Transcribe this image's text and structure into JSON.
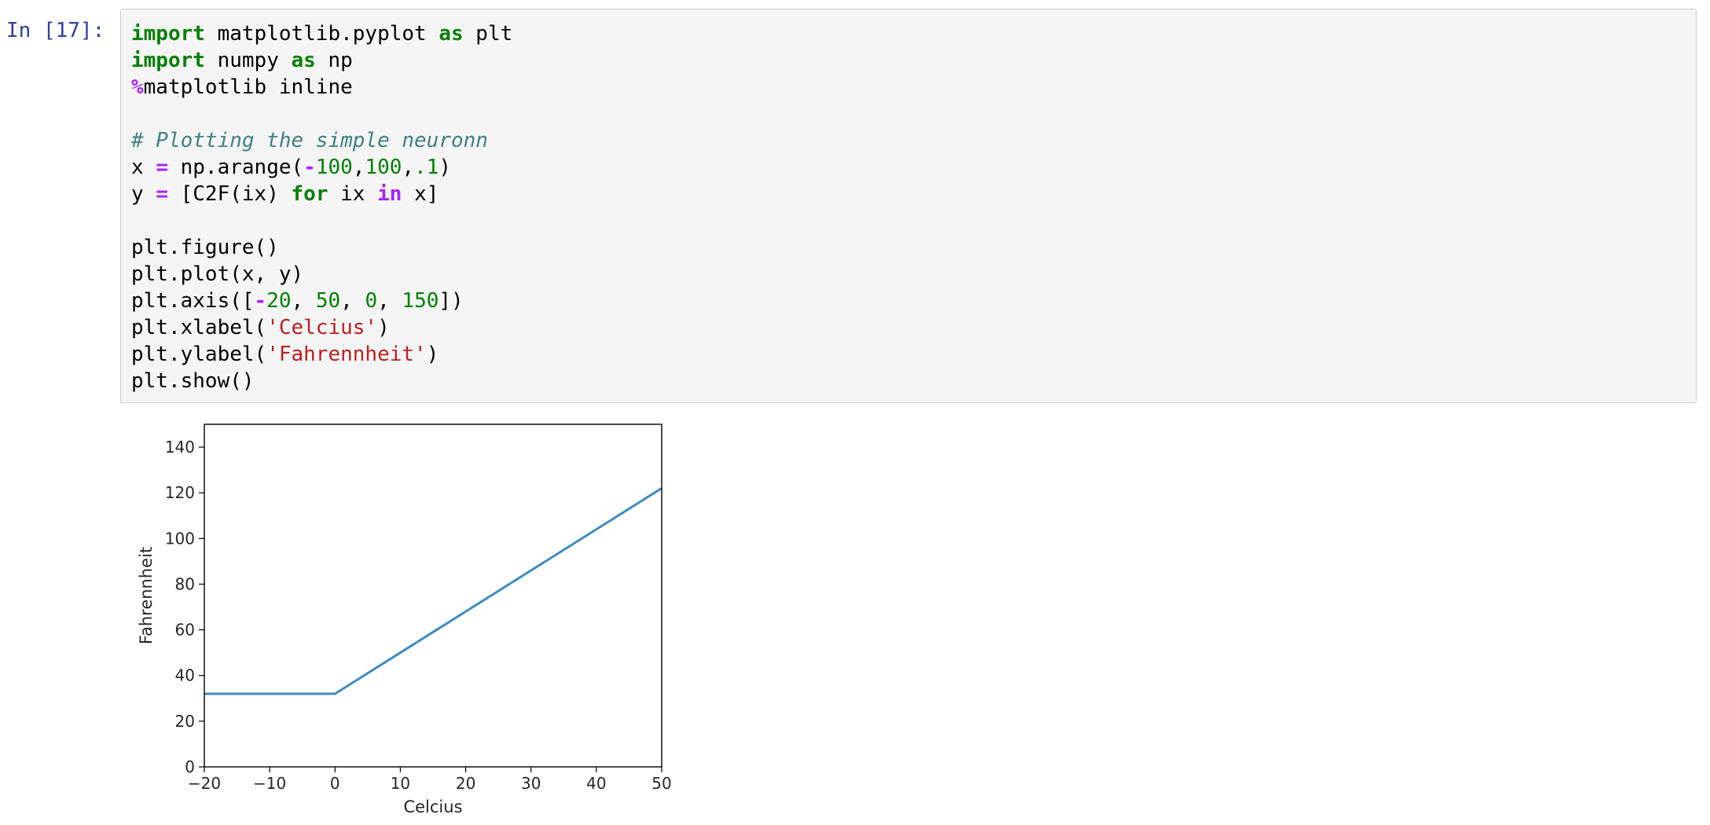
{
  "cell": {
    "prompt": "In [17]:",
    "code_lines": [
      [
        {
          "t": "import",
          "c": "#008000",
          "b": true
        },
        {
          "t": " matplotlib.pyplot "
        },
        {
          "t": "as",
          "c": "#008000",
          "b": true
        },
        {
          "t": " plt"
        }
      ],
      [
        {
          "t": "import",
          "c": "#008000",
          "b": true
        },
        {
          "t": " numpy "
        },
        {
          "t": "as",
          "c": "#008000",
          "b": true
        },
        {
          "t": " np"
        }
      ],
      [
        {
          "t": "%",
          "c": "#aa22ff",
          "b": true
        },
        {
          "t": "matplotlib inline"
        }
      ],
      [],
      [
        {
          "t": "# Plotting the simple neuronn",
          "c": "#408080",
          "i": true
        }
      ],
      [
        {
          "t": "x "
        },
        {
          "t": "=",
          "c": "#aa22ff",
          "b": true
        },
        {
          "t": " np.arange("
        },
        {
          "t": "-",
          "c": "#aa22ff",
          "b": true
        },
        {
          "t": "100",
          "c": "#008000"
        },
        {
          "t": ","
        },
        {
          "t": "100",
          "c": "#008000"
        },
        {
          "t": ","
        },
        {
          "t": ".1",
          "c": "#008000"
        },
        {
          "t": ")"
        }
      ],
      [
        {
          "t": "y "
        },
        {
          "t": "=",
          "c": "#aa22ff",
          "b": true
        },
        {
          "t": " [C2F(ix) "
        },
        {
          "t": "for",
          "c": "#008000",
          "b": true
        },
        {
          "t": " ix "
        },
        {
          "t": "in",
          "c": "#aa22ff",
          "b": true
        },
        {
          "t": " x]"
        }
      ],
      [],
      [
        {
          "t": "plt.figure()"
        }
      ],
      [
        {
          "t": "plt.plot(x, y)"
        }
      ],
      [
        {
          "t": "plt.axis(["
        },
        {
          "t": "-",
          "c": "#aa22ff",
          "b": true
        },
        {
          "t": "20",
          "c": "#008000"
        },
        {
          "t": ", "
        },
        {
          "t": "50",
          "c": "#008000"
        },
        {
          "t": ", "
        },
        {
          "t": "0",
          "c": "#008000"
        },
        {
          "t": ", "
        },
        {
          "t": "150",
          "c": "#008000"
        },
        {
          "t": "])"
        }
      ],
      [
        {
          "t": "plt.xlabel("
        },
        {
          "t": "'Celcius'",
          "c": "#ba2121"
        },
        {
          "t": ")"
        }
      ],
      [
        {
          "t": "plt.ylabel("
        },
        {
          "t": "'Fahrennheit'",
          "c": "#ba2121"
        },
        {
          "t": ")"
        }
      ],
      [
        {
          "t": "plt.show()"
        }
      ]
    ]
  },
  "chart_data": {
    "type": "line",
    "title": "",
    "xlabel": "Celcius",
    "ylabel": "Fahrennheit",
    "xlim": [
      -20,
      50
    ],
    "ylim": [
      0,
      150
    ],
    "xticks": [
      -20,
      -10,
      0,
      10,
      20,
      30,
      40,
      50
    ],
    "xtick_labels": [
      "−20",
      "−10",
      "0",
      "10",
      "20",
      "30",
      "40",
      "50"
    ],
    "yticks": [
      0,
      20,
      40,
      60,
      80,
      100,
      120,
      140
    ],
    "ytick_labels": [
      "0",
      "20",
      "40",
      "60",
      "80",
      "100",
      "120",
      "140"
    ],
    "grid": false,
    "series": [
      {
        "color": "#1f77b4",
        "x": [
          -20,
          0,
          50
        ],
        "y": [
          32,
          32,
          122
        ]
      }
    ]
  }
}
